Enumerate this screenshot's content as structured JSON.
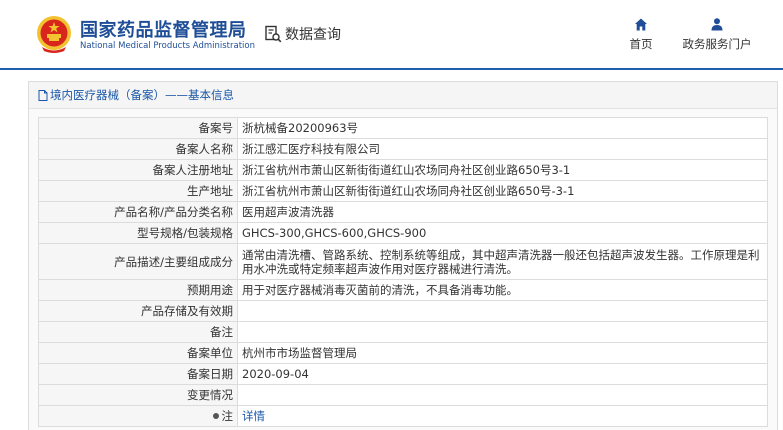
{
  "header": {
    "brand_cn": "国家药品监督管理局",
    "brand_en": "National Medical Products Administration",
    "query_label": "数据查询",
    "nav": {
      "home": "首页",
      "portal": "政务服务门户"
    }
  },
  "panel": {
    "title": "境内医疗器械（备案）——基本信息"
  },
  "record": {
    "rows": [
      {
        "key": "备案号",
        "value": "浙杭械备20200963号"
      },
      {
        "key": "备案人名称",
        "value": "浙江感汇医疗科技有限公司"
      },
      {
        "key": "备案人注册地址",
        "value": "浙江省杭州市萧山区新街街道红山农场同舟社区创业路650号3-1"
      },
      {
        "key": "生产地址",
        "value": "浙江省杭州市萧山区新街街道红山农场同舟社区创业路650号-3-1"
      },
      {
        "key": "产品名称/产品分类名称",
        "value": "医用超声波清洗器"
      },
      {
        "key": "型号规格/包装规格",
        "value": "GHCS-300,GHCS-600,GHCS-900"
      },
      {
        "key": "产品描述/主要组成成分",
        "value": "通常由清洗槽、管路系统、控制系统等组成，其中超声清洗器一般还包括超声波发生器。工作原理是利用水冲洗或特定频率超声波作用对医疗器械进行清洗。"
      },
      {
        "key": "预期用途",
        "value": "用于对医疗器械消毒灭菌前的清洗，不具备消毒功能。"
      },
      {
        "key": "产品存储及有效期",
        "value": ""
      },
      {
        "key": "备注",
        "value": ""
      },
      {
        "key": "备案单位",
        "value": "杭州市市场监督管理局"
      },
      {
        "key": "备案日期",
        "value": "2020-09-04"
      },
      {
        "key": "变更情况",
        "value": ""
      },
      {
        "key": "注",
        "value": "详情"
      }
    ]
  },
  "colors": {
    "brand_blue": "#1f4e96",
    "link_blue": "#1a57a8",
    "emblem_red": "#d8261c",
    "emblem_gold": "#f2c230"
  }
}
